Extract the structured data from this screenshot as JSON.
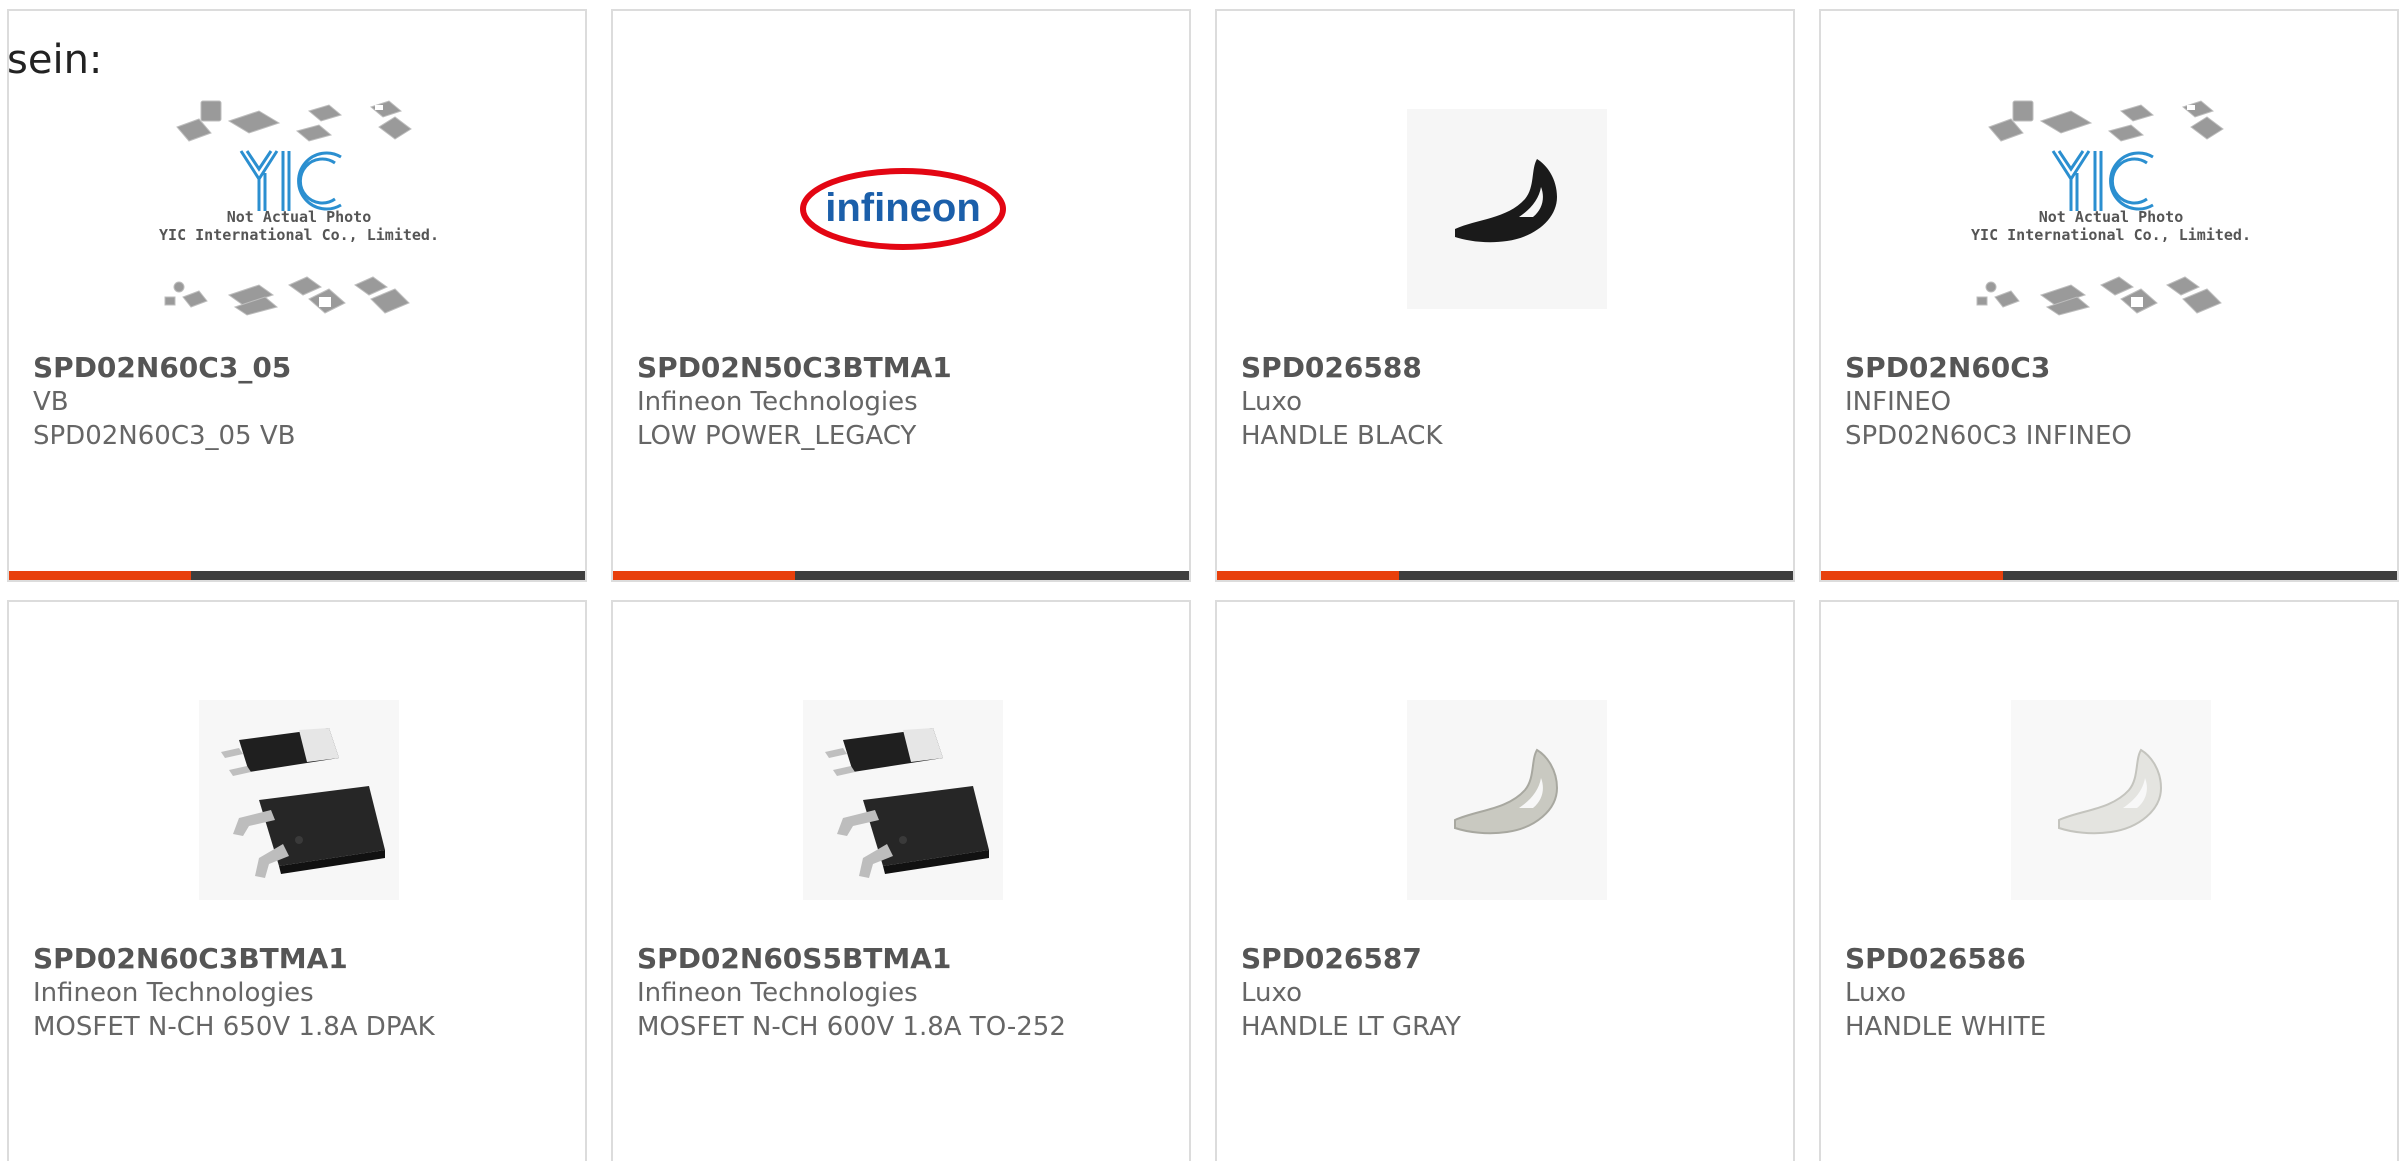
{
  "intro_text": "sein:",
  "colors": {
    "accent": "#e8400c",
    "bar_dark": "#3e3e3e",
    "border": "#dcdcdc",
    "text": "#666666",
    "infineon_red": "#e30613",
    "infineon_blue": "#1b5faa",
    "yic_blue": "#2b8fd0"
  },
  "products": [
    {
      "part": "SPD02N60C3_05",
      "maker": "VB",
      "desc": "SPD02N60C3_05 VB",
      "image": "yic-not-actual-photo",
      "placeholder_line1": "Not Actual Photo",
      "placeholder_line2": "YIC International Co., Limited.",
      "logo_text": "YIC"
    },
    {
      "part": "SPD02N50C3BTMA1",
      "maker": "Infineon Technologies",
      "desc": "LOW POWER_LEGACY",
      "image": "infineon-logo",
      "logo_text": "infineon"
    },
    {
      "part": "SPD026588",
      "maker": "Luxo",
      "desc": "HANDLE BLACK",
      "image": "handle-black"
    },
    {
      "part": "SPD02N60C3",
      "maker": "INFINEO",
      "desc": "SPD02N60C3 INFINEO",
      "image": "yic-not-actual-photo",
      "placeholder_line1": "Not Actual Photo",
      "placeholder_line2": "YIC International Co., Limited.",
      "logo_text": "YIC"
    },
    {
      "part": "SPD02N60C3BTMA1",
      "maker": "Infineon Technologies",
      "desc": "MOSFET N-CH 650V 1.8A DPAK",
      "image": "dpak-package"
    },
    {
      "part": "SPD02N60S5BTMA1",
      "maker": "Infineon Technologies",
      "desc": "MOSFET N-CH 600V 1.8A TO-252",
      "image": "dpak-package"
    },
    {
      "part": "SPD026587",
      "maker": "Luxo",
      "desc": "HANDLE LT GRAY",
      "image": "handle-lt-gray"
    },
    {
      "part": "SPD026586",
      "maker": "Luxo",
      "desc": "HANDLE WHITE",
      "image": "handle-white"
    }
  ]
}
